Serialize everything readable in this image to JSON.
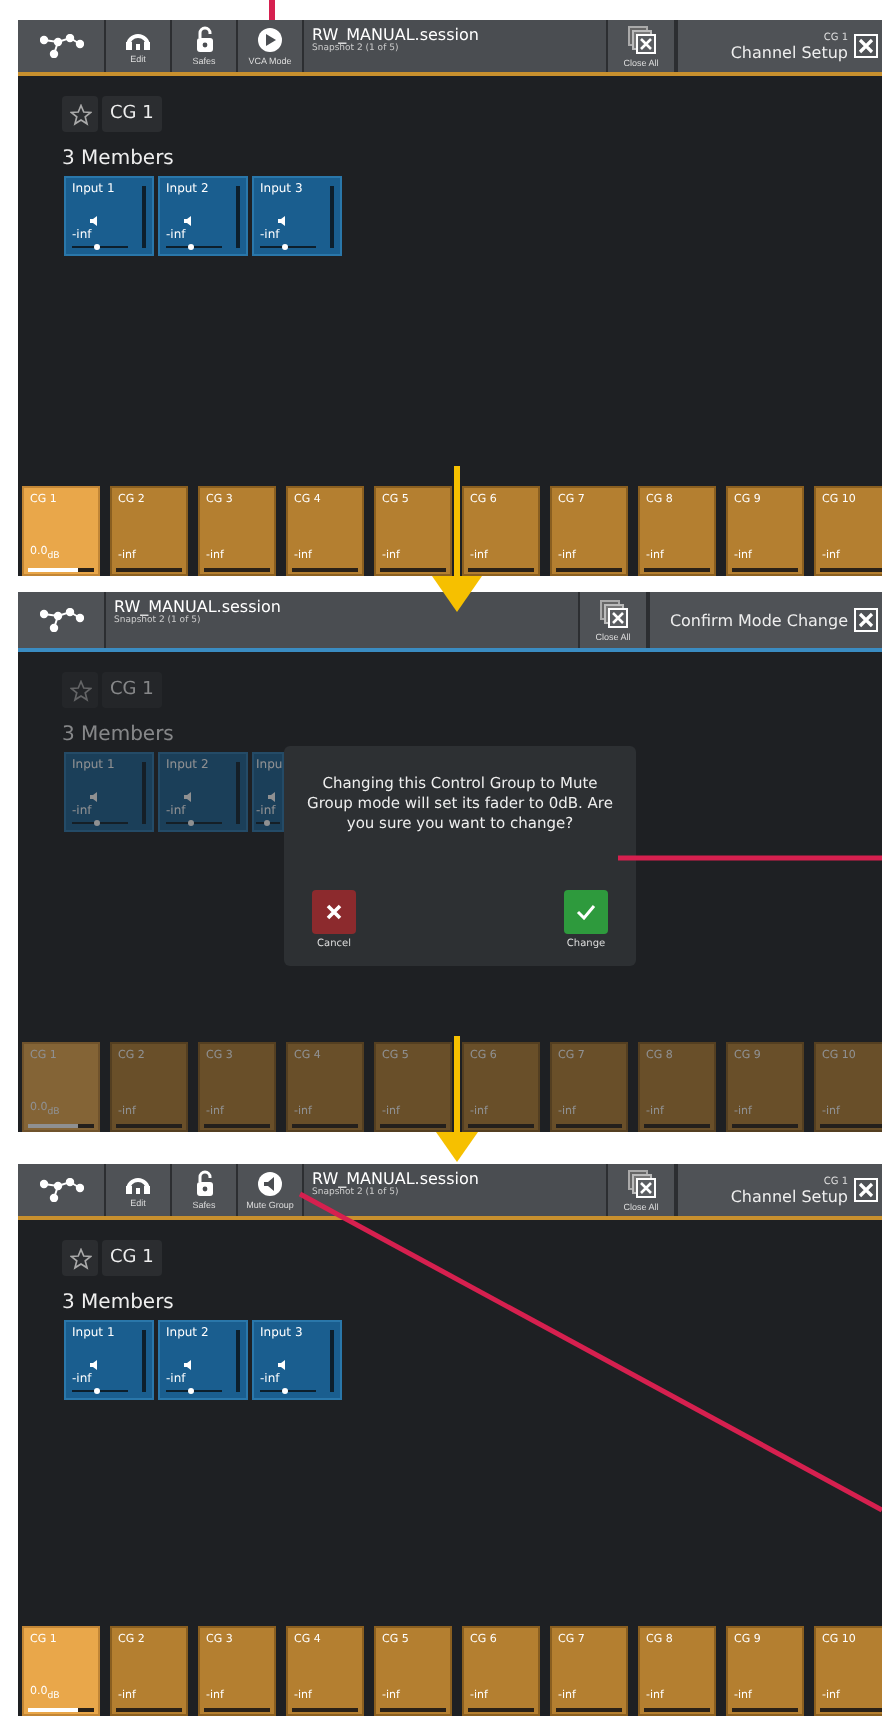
{
  "screens": [
    {
      "tools": [
        {
          "kind": "network"
        },
        {
          "kind": "edit",
          "label": "Edit"
        },
        {
          "kind": "safes",
          "label": "Safes"
        },
        {
          "kind": "vca",
          "label": "VCA Mode"
        }
      ],
      "session": "RW_MANUAL.session",
      "snapshot": "Snapshot 2 (1 of 5)",
      "close_all": "Close All",
      "panel": {
        "subtitle": "CG 1",
        "title": "Channel Setup"
      },
      "group": "CG 1",
      "members_title": "3 Members",
      "members": [
        {
          "name": "Input 1",
          "value": "-inf",
          "level": 0.45
        },
        {
          "name": "Input 2",
          "value": "-inf",
          "level": 0.45
        },
        {
          "name": "Input 3",
          "value": "-inf",
          "level": 0.45
        }
      ],
      "strip": [
        {
          "name": "CG 1",
          "value": "0.0$_{dB}$",
          "selected": true,
          "level": 0.75
        },
        {
          "name": "CG 2",
          "value": "-inf",
          "selected": false,
          "level": 0
        },
        {
          "name": "CG 3",
          "value": "-inf",
          "selected": false,
          "level": 0
        },
        {
          "name": "CG 4",
          "value": "-inf",
          "selected": false,
          "level": 0
        },
        {
          "name": "CG 5",
          "value": "-inf",
          "selected": false,
          "level": 0
        },
        {
          "name": "CG 6",
          "value": "-inf",
          "selected": false,
          "level": 0
        },
        {
          "name": "CG 7",
          "value": "-inf",
          "selected": false,
          "level": 0
        },
        {
          "name": "CG 8",
          "value": "-inf",
          "selected": false,
          "level": 0
        },
        {
          "name": "CG 9",
          "value": "-inf",
          "selected": false,
          "level": 0
        },
        {
          "name": "CG 10",
          "value": "-inf",
          "selected": false,
          "level": 0
        }
      ]
    },
    {
      "tools": [
        {
          "kind": "network"
        }
      ],
      "session": "RW_MANUAL.session",
      "snapshot": "Snapshot 2 (1 of 5)",
      "close_all": "Close All",
      "panel": {
        "title": "Confirm Mode Change"
      },
      "group": "CG 1",
      "members_title": "3 Members",
      "members": [
        {
          "name": "Input 1",
          "value": "-inf",
          "level": 0.45
        },
        {
          "name": "Input 2",
          "value": "-inf",
          "level": 0.45
        },
        {
          "name": "Inpu",
          "value": "-inf",
          "level": 0.45
        }
      ],
      "dialog": {
        "message": "Changing this Control Group to Mute Group mode will set its fader to 0dB. Are you sure you want to change?",
        "buttons": [
          {
            "kind": "cancel",
            "label": "Cancel"
          },
          {
            "kind": "confirm",
            "label": "Change"
          }
        ]
      },
      "strip": [
        {
          "name": "CG 1",
          "value": "0.0$_{dB}$",
          "selected": true,
          "level": 0.75
        },
        {
          "name": "CG 2",
          "value": "-inf",
          "selected": false,
          "level": 0
        },
        {
          "name": "CG 3",
          "value": "-inf",
          "selected": false,
          "level": 0
        },
        {
          "name": "CG 4",
          "value": "-inf",
          "selected": false,
          "level": 0
        },
        {
          "name": "CG 5",
          "value": "-inf",
          "selected": false,
          "level": 0
        },
        {
          "name": "CG 6",
          "value": "-inf",
          "selected": false,
          "level": 0
        },
        {
          "name": "CG 7",
          "value": "-inf",
          "selected": false,
          "level": 0
        },
        {
          "name": "CG 8",
          "value": "-inf",
          "selected": false,
          "level": 0
        },
        {
          "name": "CG 9",
          "value": "-inf",
          "selected": false,
          "level": 0
        },
        {
          "name": "CG 10",
          "value": "-inf",
          "selected": false,
          "level": 0
        }
      ]
    },
    {
      "tools": [
        {
          "kind": "network"
        },
        {
          "kind": "edit",
          "label": "Edit"
        },
        {
          "kind": "safes",
          "label": "Safes"
        },
        {
          "kind": "mute",
          "label": "Mute Group"
        }
      ],
      "session": "RW_MANUAL.session",
      "snapshot": "Snapshot 2 (1 of 5)",
      "close_all": "Close All",
      "panel": {
        "subtitle": "CG 1",
        "title": "Channel Setup"
      },
      "group": "CG 1",
      "members_title": "3 Members",
      "members": [
        {
          "name": "Input 1",
          "value": "-inf",
          "level": 0.45
        },
        {
          "name": "Input 2",
          "value": "-inf",
          "level": 0.45
        },
        {
          "name": "Input 3",
          "value": "-inf",
          "level": 0.45
        }
      ],
      "strip": [
        {
          "name": "CG 1",
          "value": "0.0$_{dB}$",
          "selected": true,
          "level": 0.75
        },
        {
          "name": "CG 2",
          "value": "-inf",
          "selected": false,
          "level": 0
        },
        {
          "name": "CG 3",
          "value": "-inf",
          "selected": false,
          "level": 0
        },
        {
          "name": "CG 4",
          "value": "-inf",
          "selected": false,
          "level": 0
        },
        {
          "name": "CG 5",
          "value": "-inf",
          "selected": false,
          "level": 0
        },
        {
          "name": "CG 6",
          "value": "-inf",
          "selected": false,
          "level": 0
        },
        {
          "name": "CG 7",
          "value": "-inf",
          "selected": false,
          "level": 0
        },
        {
          "name": "CG 8",
          "value": "-inf",
          "selected": false,
          "level": 0
        },
        {
          "name": "CG 9",
          "value": "-inf",
          "selected": false,
          "level": 0
        },
        {
          "name": "CG 10",
          "value": "-inf",
          "selected": false,
          "level": 0
        }
      ]
    }
  ]
}
